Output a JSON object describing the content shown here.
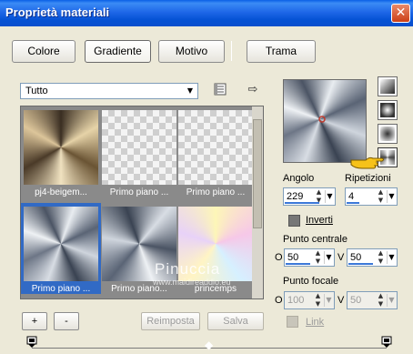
{
  "window": {
    "title": "Proprietà materiali",
    "close_label": "✕"
  },
  "tabs": [
    {
      "label": "Colore",
      "active": false
    },
    {
      "label": "Gradiente",
      "active": true
    },
    {
      "label": "Motivo",
      "active": false
    },
    {
      "label": "Trama",
      "active": false
    }
  ],
  "category": {
    "selected": "Tutto"
  },
  "gallery": {
    "items": [
      {
        "caption": "pj4-beigem...",
        "style": "beige-radial"
      },
      {
        "caption": "Primo piano ...",
        "style": "checker-light"
      },
      {
        "caption": "Primo piano ...",
        "style": "checker-light"
      },
      {
        "caption": "Primo piano ...",
        "style": "steel-conic",
        "selected": true
      },
      {
        "caption": "Primo piano...",
        "style": "steel-conic"
      },
      {
        "caption": "princemps",
        "style": "pastel"
      }
    ]
  },
  "gradient_styles": [
    "linear",
    "rectangular",
    "radial",
    "sunburst"
  ],
  "angle": {
    "label": "Angolo",
    "value": "229"
  },
  "repeats": {
    "label": "Ripetizioni",
    "value": "4"
  },
  "invert": {
    "label": "Inverti"
  },
  "center_point": {
    "label": "Punto centrale",
    "o_label": "O",
    "v_label": "V",
    "o_value": "50",
    "v_value": "50"
  },
  "focal_point": {
    "label": "Punto focale",
    "o_label": "O",
    "v_label": "V",
    "o_value": "100",
    "v_value": "50"
  },
  "link": {
    "label": "Link"
  },
  "buttons": {
    "add": "+",
    "remove": "-",
    "reset": "Reimposta",
    "save": "Salva"
  },
  "watermark": {
    "text": "Pinuccia",
    "sub": "www.maidireaddio.eu"
  },
  "colors": {
    "titlebar": "#0a5fe6",
    "selection": "#316ac5",
    "accent_bar": "#3c78d8"
  }
}
